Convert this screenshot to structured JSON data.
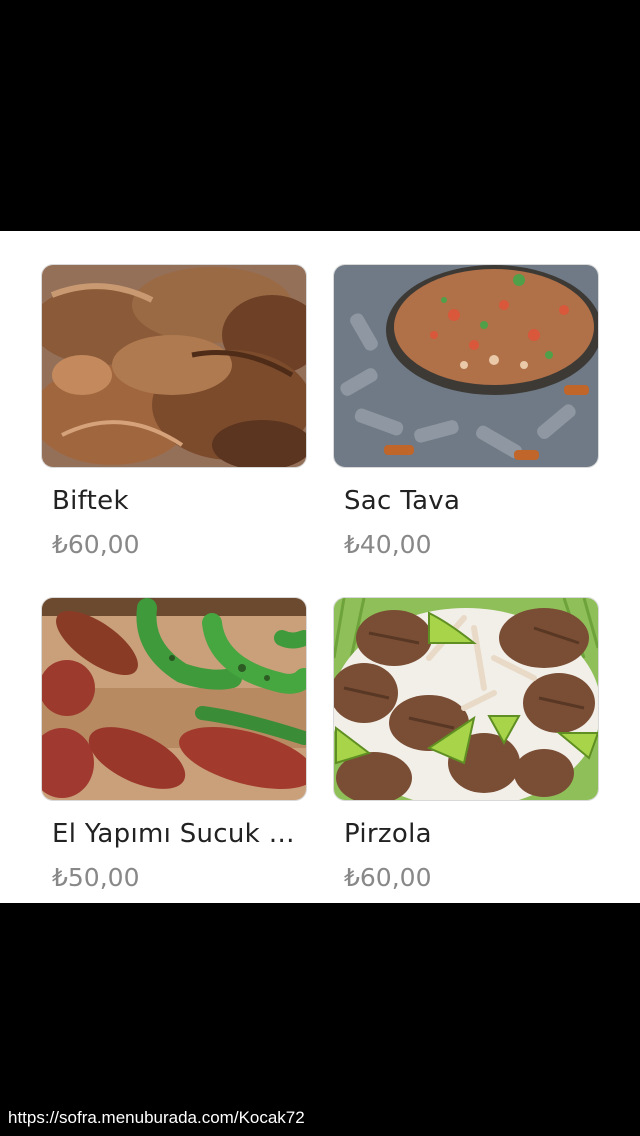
{
  "menu": {
    "items": [
      {
        "name": "Biftek",
        "price": "₺60,00",
        "image": "steak-photo"
      },
      {
        "name": "Sac Tava",
        "price": "₺40,00",
        "image": "sac-tava-photo"
      },
      {
        "name": "El Yapımı Sucuk I...",
        "price": "₺50,00",
        "image": "sucuk-photo"
      },
      {
        "name": "Pirzola",
        "price": "₺60,00",
        "image": "lamb-chops-photo"
      }
    ]
  },
  "footer": {
    "url": "https://sofra.menuburada.com/Kocak72"
  },
  "colors": {
    "background": "#ffffff",
    "letterbox": "#000000",
    "name_text": "#222222",
    "price_text": "#888888",
    "card_border": "#d9d9d9"
  }
}
